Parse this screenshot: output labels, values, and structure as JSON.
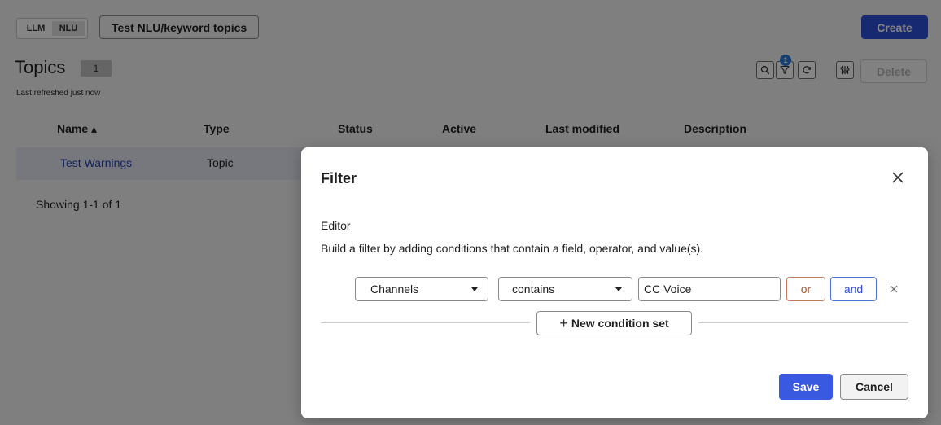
{
  "header": {
    "segment": [
      {
        "label": "LLM"
      },
      {
        "label": "NLU"
      }
    ],
    "test_button": "Test NLU/keyword topics",
    "create_button": "Create"
  },
  "page": {
    "title": "Topics",
    "count": "1",
    "refreshed": "Last refreshed just now"
  },
  "toolbar": {
    "filter_count": "1",
    "delete_button": "Delete",
    "icons": [
      "search-icon",
      "filter-icon",
      "refresh-icon",
      "settings-icon"
    ]
  },
  "table": {
    "columns": [
      "Name ▴",
      "Type",
      "Status",
      "Active",
      "Last modified",
      "Description"
    ],
    "rows": [
      {
        "name": "Test Warnings",
        "type": "Topic"
      }
    ],
    "footer": "Showing 1-1 of 1"
  },
  "modal": {
    "title": "Filter",
    "section_title": "Editor",
    "help_text": "Build a filter by adding conditions that contain a field, operator, and value(s).",
    "condition": {
      "field": "Channels",
      "operator": "contains",
      "value": "CC Voice"
    },
    "or_label": "or",
    "and_label": "and",
    "new_condition_set": "New condition set",
    "save": "Save",
    "cancel": "Cancel"
  },
  "colors": {
    "primary": "#2d4fd6",
    "link": "#2843b8",
    "or_accent": "#b5532a"
  }
}
